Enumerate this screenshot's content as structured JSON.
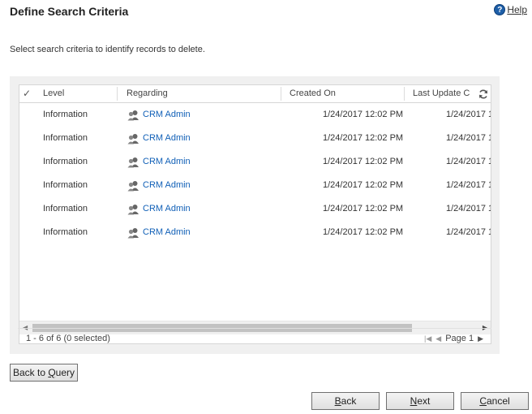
{
  "page": {
    "title": "Define Search Criteria",
    "help_label": "Help",
    "instructions": "Select search criteria to identify records to delete."
  },
  "grid": {
    "columns": {
      "check": "✓",
      "level": "Level",
      "regarding": "Regarding",
      "created_on": "Created On",
      "last_updated": "Last Update C"
    },
    "rows": [
      {
        "level": "Information",
        "regarding": "CRM Admin",
        "created_on": "1/24/2017 12:02 PM",
        "last_updated": "1/24/2017 1"
      },
      {
        "level": "Information",
        "regarding": "CRM Admin",
        "created_on": "1/24/2017 12:02 PM",
        "last_updated": "1/24/2017 1"
      },
      {
        "level": "Information",
        "regarding": "CRM Admin",
        "created_on": "1/24/2017 12:02 PM",
        "last_updated": "1/24/2017 1"
      },
      {
        "level": "Information",
        "regarding": "CRM Admin",
        "created_on": "1/24/2017 12:02 PM",
        "last_updated": "1/24/2017 1"
      },
      {
        "level": "Information",
        "regarding": "CRM Admin",
        "created_on": "1/24/2017 12:02 PM",
        "last_updated": "1/24/2017 1"
      },
      {
        "level": "Information",
        "regarding": "CRM Admin",
        "created_on": "1/24/2017 12:02 PM",
        "last_updated": "1/24/2017 1"
      }
    ],
    "record_count": "1 - 6 of 6 (0 selected)",
    "page_label": "Page 1"
  },
  "buttons": {
    "back_to_query_pre": "Back to ",
    "back_to_query_key": "Q",
    "back_to_query_post": "uery",
    "back_key": "B",
    "back_rest": "ack",
    "next_key": "N",
    "next_rest": "ext",
    "cancel_key": "C",
    "cancel_rest": "ancel"
  },
  "colors": {
    "link": "#1160b7",
    "help_icon": "#1e5fa8"
  }
}
